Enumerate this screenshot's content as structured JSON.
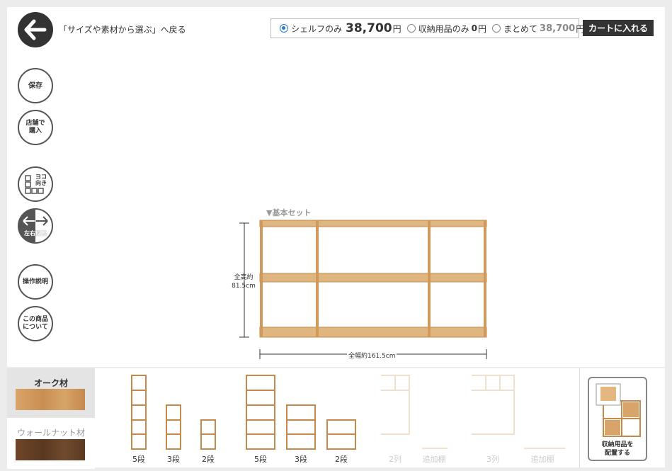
{
  "header": {
    "back_label": "「サイズや素材から選ぶ」へ戻る",
    "cart_button": "カートに入れる"
  },
  "price_options": [
    {
      "label": "シェルフのみ",
      "price": "38,700",
      "unit": "円",
      "selected": true
    },
    {
      "label": "収納用品のみ",
      "price": "0",
      "unit": "円",
      "selected": false
    },
    {
      "label": "まとめて",
      "price": "38,700",
      "unit": "円",
      "selected": false
    }
  ],
  "sidebar": {
    "save": "保存",
    "store_line1": "店舗で",
    "store_line2": "購入",
    "yoko_line1": "ヨコ",
    "yoko_line2": "向き",
    "flip": "左右反転",
    "howto": "操作説明",
    "about_line1": "この商品",
    "about_line2": "について"
  },
  "canvas": {
    "set_label": "▼基本セット",
    "height_line1": "全高約",
    "height_line2": "81.5cm",
    "width_label": "全幅約161.5cm"
  },
  "materials": [
    {
      "name": "オーク材",
      "active": true
    },
    {
      "name": "ウォールナット材",
      "active": false
    }
  ],
  "thumbnails": [
    {
      "label": "5段"
    },
    {
      "label": "3段"
    },
    {
      "label": "2段"
    },
    {
      "label": "5段"
    },
    {
      "label": "3段"
    },
    {
      "label": "2段"
    },
    {
      "label": "2列"
    },
    {
      "label": "追加棚"
    },
    {
      "label": "3列"
    },
    {
      "label": "追加棚"
    }
  ],
  "place_items": {
    "line1": "収納用品を",
    "line2": "配置する"
  },
  "colors": {
    "wood": "#d9a46a",
    "wood_edge": "#c48a4c",
    "dark": "#333333",
    "accent": "#2a7bd2"
  }
}
